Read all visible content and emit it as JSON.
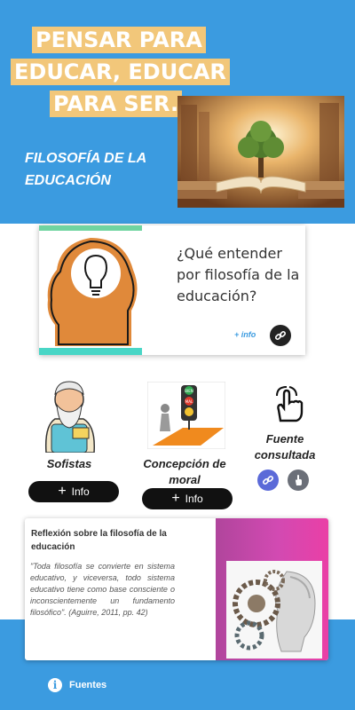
{
  "header": {
    "title_lines": [
      "PENSAR PARA",
      "EDUCAR, EDUCAR",
      "PARA SER."
    ],
    "subtitle": "FILOSOFÍA DE LA EDUCACIÓN"
  },
  "card_question": {
    "question": "¿Qué entender por filosofía de la educación?",
    "info_link": "+ info"
  },
  "columns": {
    "sofistas": {
      "label": "Sofistas",
      "button": "Info"
    },
    "moral": {
      "label": "Concepción de moral",
      "button": "Info"
    },
    "fuente": {
      "label": "Fuente consultada"
    }
  },
  "traffic_light": {
    "top": "BIEN",
    "middle": "MAL"
  },
  "reflection": {
    "title": "Reflexión sobre la filosofía de la educación",
    "quote": "\"Toda filosofía se convierte en sistema educativo, y viceversa, todo sistema educativo tiene como base consciente o inconscientemente un fundamento filosófico\". (Aguirre, 2011, pp. 42)"
  },
  "footer": {
    "fuentes_label": "Fuentes"
  },
  "icons": [
    "link-icon",
    "hand-pointer-icon",
    "plus-icon",
    "info-icon",
    "lightbulb-icon"
  ],
  "colors": {
    "primary_blue": "#3b9be0",
    "title_highlight": "#f2c77a",
    "pink": "#e03fa8"
  }
}
